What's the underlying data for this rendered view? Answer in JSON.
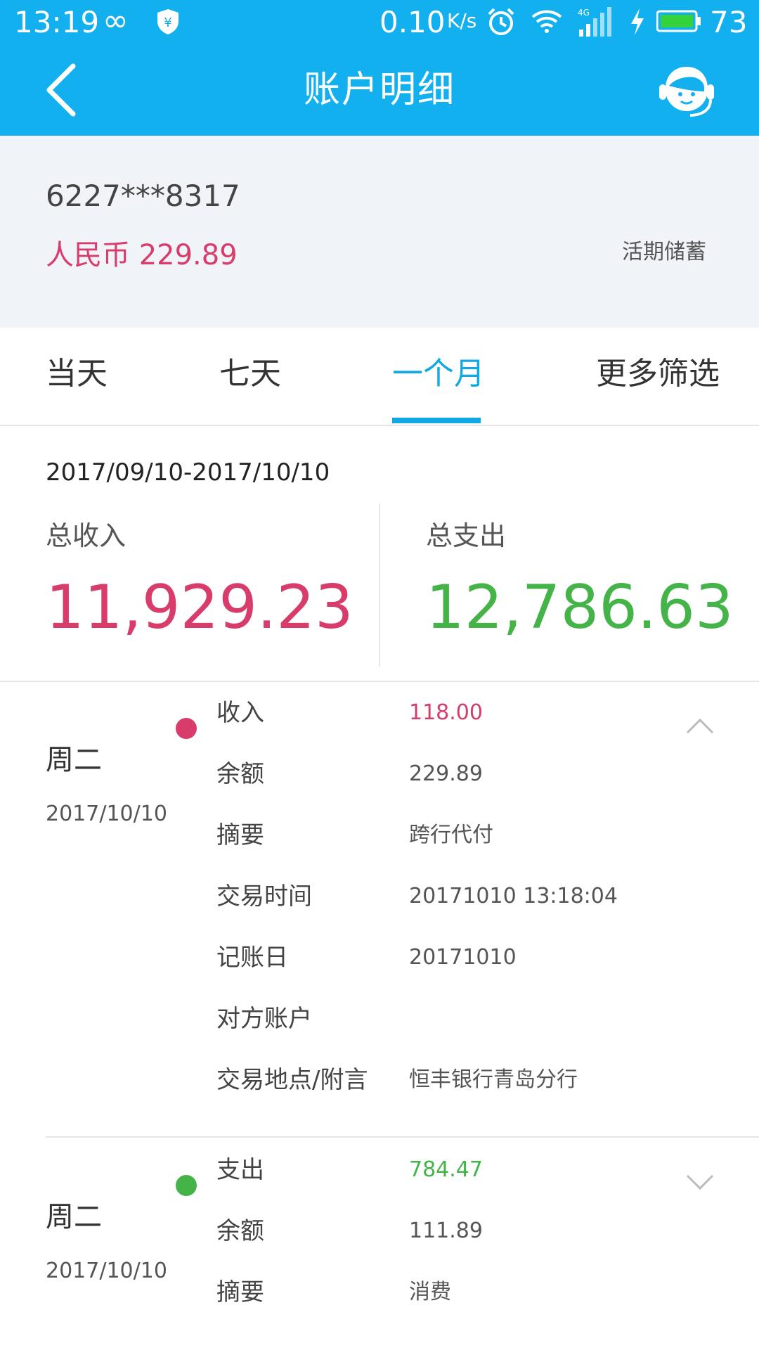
{
  "status_bar": {
    "time": "13:19",
    "network_speed": "0.10",
    "network_speed_unit": "K/s",
    "battery_level": "73",
    "icons": [
      "infinity-icon",
      "shield-yen-icon",
      "alarm-icon",
      "wifi-icon",
      "signal-4g-icon",
      "charging-icon",
      "battery-icon"
    ]
  },
  "header": {
    "title": "账户明细",
    "icons": [
      "back-arrow-icon",
      "customer-service-icon"
    ]
  },
  "account": {
    "number": "6227***8317",
    "balance": "人民币 229.89",
    "type": "活期储蓄"
  },
  "tabs": [
    {
      "label": "当天",
      "selected": false
    },
    {
      "label": "七天",
      "selected": false
    },
    {
      "label": "一个月",
      "selected": true
    },
    {
      "label": "更多筛选",
      "selected": false
    }
  ],
  "summary": {
    "date_range": "2017/09/10-2017/10/10",
    "income_label": "总收入",
    "income_value": "11,929.23",
    "expense_label": "总支出",
    "expense_value": "12,786.63"
  },
  "transactions": [
    {
      "weekday": "周二",
      "date": "2017/10/10",
      "dot_color": "#d83c6a",
      "expanded": true,
      "rows": [
        {
          "label": "收入",
          "value": "118.00",
          "value_color": "#d83c6a"
        },
        {
          "label": "余额",
          "value": "229.89"
        },
        {
          "label": "摘要",
          "value": "跨行代付"
        },
        {
          "label": "交易时间",
          "value": "20171010 13:18:04"
        },
        {
          "label": "记账日",
          "value": "20171010"
        },
        {
          "label": "对方账户",
          "value": ""
        },
        {
          "label": "交易地点/附言",
          "value": "恒丰银行青岛分行"
        }
      ]
    },
    {
      "weekday": "周二",
      "date": "2017/10/10",
      "dot_color": "#44b449",
      "expanded": false,
      "rows": [
        {
          "label": "支出",
          "value": "784.47",
          "value_color": "#44b449"
        },
        {
          "label": "余额",
          "value": "111.89"
        },
        {
          "label": "摘要",
          "value": "消费"
        }
      ]
    }
  ],
  "colors": {
    "header_blue": "#12b0ee",
    "tab_active": "#12a8e6",
    "income_red": "#d83c6a",
    "expense_green": "#44b449"
  }
}
